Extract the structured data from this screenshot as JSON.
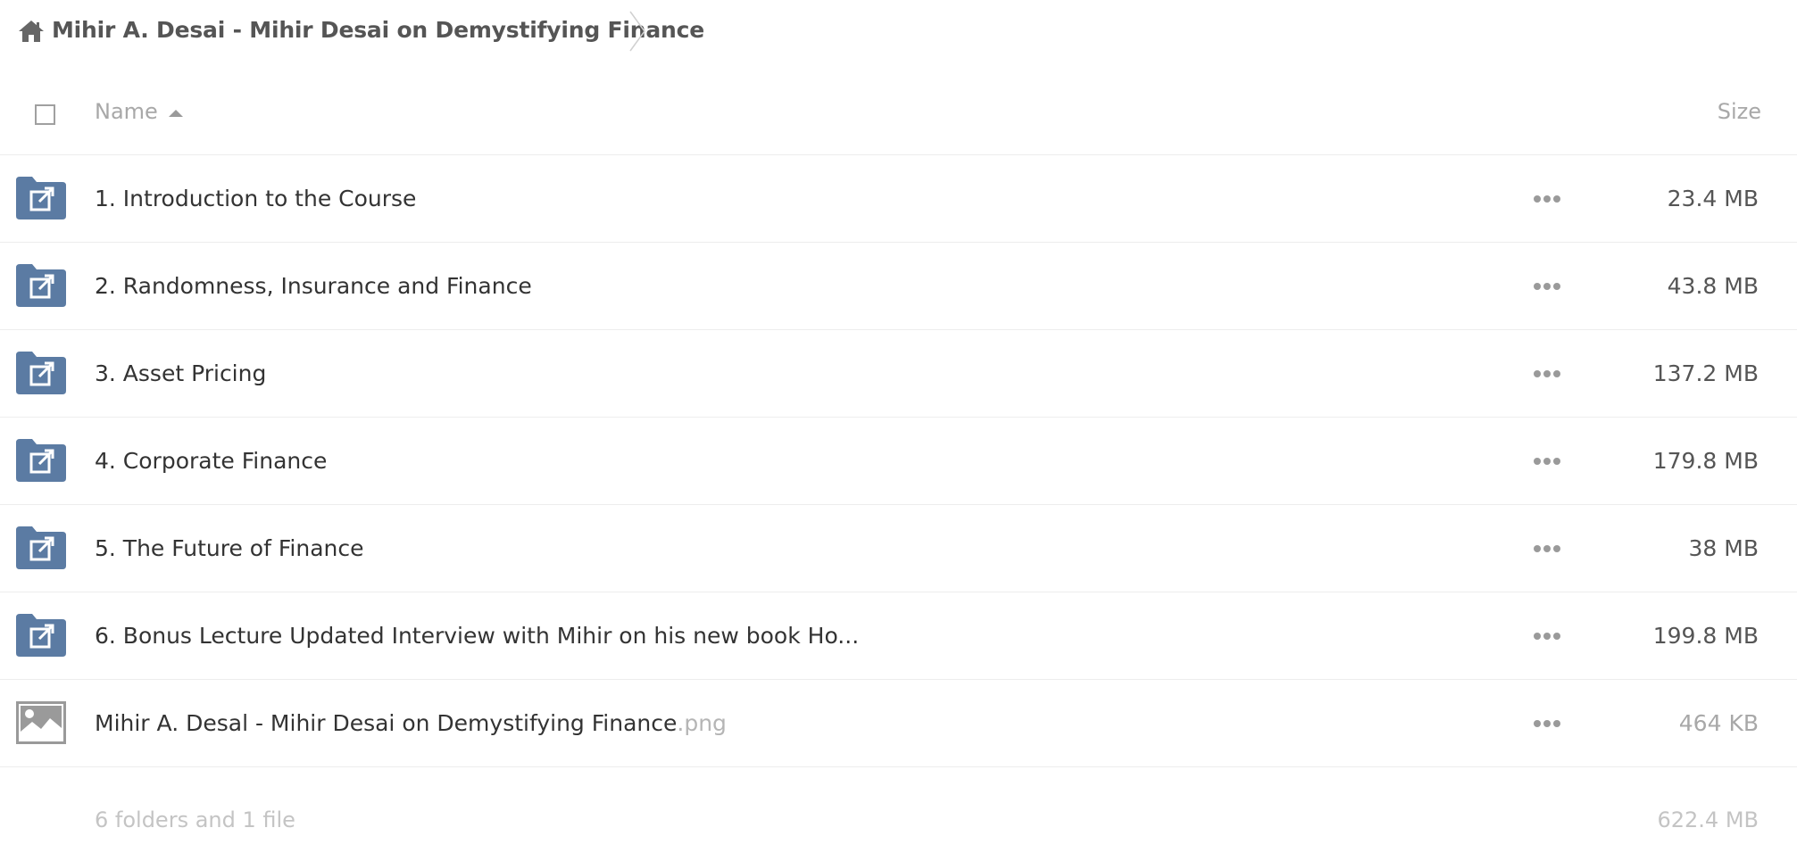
{
  "breadcrumb": {
    "home_icon": "home-icon",
    "title": "Mihir A. Desai - Mihir Desai on Demystifying Finance"
  },
  "header": {
    "name_label": "Name",
    "size_label": "Size",
    "sort": "name-ascending"
  },
  "rows": [
    {
      "type": "shared-folder",
      "icon": "shared-folder-icon",
      "name": "1. Introduction to the Course",
      "ext": "",
      "size": "23.4 MB"
    },
    {
      "type": "shared-folder",
      "icon": "shared-folder-icon",
      "name": "2. Randomness, Insurance and Finance",
      "ext": "",
      "size": "43.8 MB"
    },
    {
      "type": "shared-folder",
      "icon": "shared-folder-icon",
      "name": "3. Asset Pricing",
      "ext": "",
      "size": "137.2 MB"
    },
    {
      "type": "shared-folder",
      "icon": "shared-folder-icon",
      "name": "4. Corporate Finance",
      "ext": "",
      "size": "179.8 MB"
    },
    {
      "type": "shared-folder",
      "icon": "shared-folder-icon",
      "name": "5. The Future of Finance",
      "ext": "",
      "size": "38 MB"
    },
    {
      "type": "shared-folder",
      "icon": "shared-folder-icon",
      "name": "6. Bonus Lecture Updated Interview with Mihir on his new book Ho...",
      "ext": "",
      "size": "199.8 MB"
    },
    {
      "type": "image",
      "icon": "image-file-icon",
      "name": "Mihir A. Desal - Mihir Desai on Demystifying Finance",
      "ext": ".png",
      "size": "464 KB"
    }
  ],
  "summary": {
    "text": "6 folders and 1 file",
    "size": "622.4 MB"
  },
  "colors": {
    "folder_blue": "#5b7ba3",
    "image_gray": "#9a9a9a"
  }
}
